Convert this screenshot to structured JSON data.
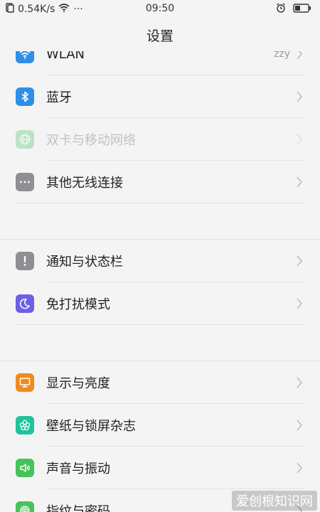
{
  "status_bar": {
    "speed": "0.54K/s",
    "time": "09:50",
    "more": "···"
  },
  "header": {
    "title": "设置"
  },
  "colors": {
    "wlan": "#2f8fe8",
    "bluetooth": "#2f8fe8",
    "sim": "#52c46a",
    "other": "#8e8e93",
    "notification": "#8e8e93",
    "dnd": "#6e5fe6",
    "display": "#f08a1c",
    "wallpaper": "#20c39c",
    "sound": "#46c35b",
    "fingerprint": "#46c35b"
  },
  "items": {
    "wlan": {
      "label": "WLAN",
      "value": "zzy",
      "icon": "wifi-icon"
    },
    "bluetooth": {
      "label": "蓝牙",
      "icon": "bluetooth-icon"
    },
    "sim": {
      "label": "双卡与移动网络",
      "icon": "globe-icon"
    },
    "other": {
      "label": "其他无线连接",
      "icon": "more-dots-icon"
    },
    "notification": {
      "label": "通知与状态栏",
      "icon": "exclamation-icon"
    },
    "dnd": {
      "label": "免打扰模式",
      "icon": "moon-icon"
    },
    "display": {
      "label": "显示与亮度",
      "icon": "monitor-icon"
    },
    "wallpaper": {
      "label": "壁纸与锁屏杂志",
      "icon": "flower-icon"
    },
    "sound": {
      "label": "声音与振动",
      "icon": "speaker-icon"
    },
    "fingerprint": {
      "label": "指纹与密码",
      "icon": "fingerprint-icon"
    }
  },
  "watermark": "爱创根知识网"
}
